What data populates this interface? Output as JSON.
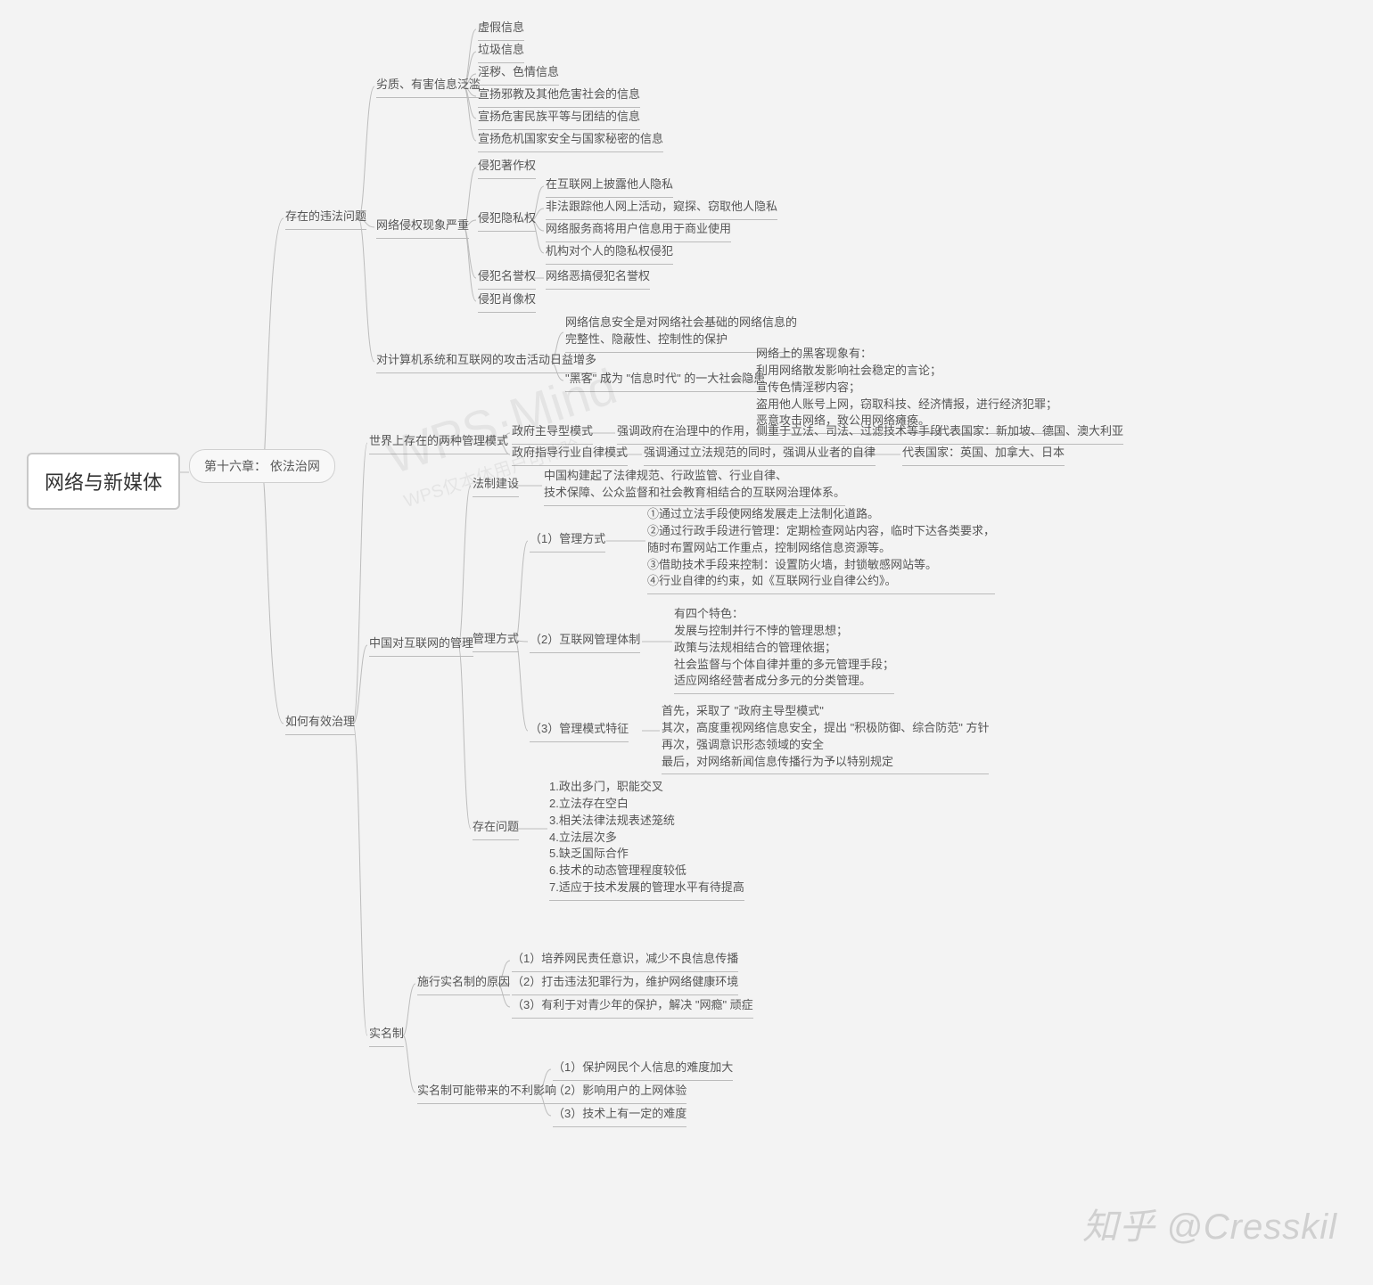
{
  "root": "网络与新媒体",
  "chapter": "第十六章：\n依法治网",
  "watermark_main": "WPS·Mind",
  "watermark_sub": "WPS仅本体用户可体验",
  "attrib": "知乎 @Cresskil",
  "b1": "存在的违法问题",
  "b1_c1": "劣质、有害信息泛滥",
  "b1_c1_1": "虚假信息",
  "b1_c1_2": "垃圾信息",
  "b1_c1_3": "淫秽、色情信息",
  "b1_c1_4": "宣扬邪教及其他危害社会的信息",
  "b1_c1_5": "宣扬危害民族平等与团结的信息",
  "b1_c1_6": "宣扬危机国家安全与国家秘密的信息",
  "b1_c2": "网络侵权现象严重",
  "b1_c2_1": "侵犯著作权",
  "b1_c2_2": "侵犯隐私权",
  "b1_c2_2_1": "在互联网上披露他人隐私",
  "b1_c2_2_2": "非法跟踪他人网上活动，窥探、窃取他人隐私",
  "b1_c2_2_3": "网络服务商将用户信息用于商业使用",
  "b1_c2_2_4": "机构对个人的隐私权侵犯",
  "b1_c2_3": "侵犯名誉权",
  "b1_c2_3_1": "网络恶搞侵犯名誉权",
  "b1_c2_4": "侵犯肖像权",
  "b1_c3": "对计算机系统和互联网的攻击活动日益增多",
  "b1_c3_1": "网络信息安全是对网络社会基础的网络信息的\n完整性、隐蔽性、控制性的保护",
  "b1_c3_2": "\"黑客\" 成为 \"信息时代\" 的一大社会隐患",
  "b1_c3_2_1": "网络上的黑客现象有：\n利用网络散发影响社会稳定的言论；\n宣传色情淫秽内容；\n盗用他人账号上网，窃取科技、经济情报，进行经济犯罪；\n恶意攻击网络，致公用网络瘫痪。",
  "b2": "如何有效治理",
  "b2_c1": "世界上存在的两种管理模式",
  "b2_c1_1": "政府主导型模式",
  "b2_c1_1_1": "强调政府在治理中的作用，侧重于立法、司法、过滤技术等手段",
  "b2_c1_1_2": "代表国家：新加坡、德国、澳大利亚",
  "b2_c1_2": "政府指导行业自律模式",
  "b2_c1_2_1": "强调通过立法规范的同时，强调从业者的自律",
  "b2_c1_2_2": "代表国家：英国、加拿大、日本",
  "b2_c2": "中国对互联网的管理",
  "b2_c2_1": "法制建设",
  "b2_c2_1_1": "中国构建起了法律规范、行政监管、行业自律、\n技术保障、公众监督和社会教育相结合的互联网治理体系。",
  "b2_c2_2": "管理方式",
  "b2_c2_2_1": "（1）管理方式",
  "b2_c2_2_1_1": "①通过立法手段使网络发展走上法制化道路。\n②通过行政手段进行管理：定期检查网站内容，临时下达各类要求，\n随时布置网站工作重点，控制网络信息资源等。\n③借助技术手段来控制：设置防火墙，封锁敏感网站等。\n④行业自律的约束，如《互联网行业自律公约》。",
  "b2_c2_2_2": "（2）互联网管理体制",
  "b2_c2_2_2_1": "有四个特色：\n发展与控制并行不悖的管理思想；\n政策与法规相结合的管理依据；\n社会监督与个体自律并重的多元管理手段；\n适应网络经营者成分多元的分类管理。",
  "b2_c2_2_3": "（3）管理模式特征",
  "b2_c2_2_3_1": "首先，采取了 \"政府主导型模式\"\n其次，高度重视网络信息安全，提出 \"积极防御、综合防范\" 方针\n再次，强调意识形态领域的安全\n最后，对网络新闻信息传播行为予以特别规定",
  "b2_c2_3": "存在问题",
  "b2_c2_3_1": "1.政出多门，职能交叉\n2.立法存在空白\n3.相关法律法规表述笼统\n4.立法层次多\n5.缺乏国际合作\n6.技术的动态管理程度较低\n7.适应于技术发展的管理水平有待提高",
  "b2_c3": "实名制",
  "b2_c3_1": "施行实名制的原因",
  "b2_c3_1_1": "（1）培养网民责任意识，减少不良信息传播",
  "b2_c3_1_2": "（2）打击违法犯罪行为，维护网络健康环境",
  "b2_c3_1_3": "（3）有利于对青少年的保护，解决 \"网瘾\" 顽症",
  "b2_c3_2": "实名制可能带来的不利影响",
  "b2_c3_2_1": "（1）保护网民个人信息的难度加大",
  "b2_c3_2_2": "（2）影响用户的上网体验",
  "b2_c3_2_3": "（3）技术上有一定的难度"
}
